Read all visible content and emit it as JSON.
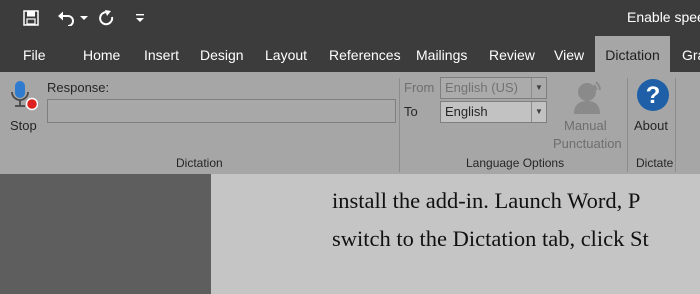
{
  "colors": {
    "title_bar": "#3c3c3c",
    "ribbon": "#a6a6a6",
    "document_page": "#c5c5c5",
    "document_gutter": "#5e5e5e",
    "mic_accent": "#2e7bcf",
    "stop_dot": "#e02020",
    "help_circle": "#1e5fa8"
  },
  "qat": {
    "save_icon": "save-icon",
    "undo_icon": "undo-icon",
    "undo_dropdown_icon": "chevron-down-icon",
    "redo_icon": "redo-icon",
    "customize_icon": "customize-qat-icon"
  },
  "title": {
    "text": "Enable spee"
  },
  "tabs": [
    {
      "label": "File"
    },
    {
      "label": "Home"
    },
    {
      "label": "Insert"
    },
    {
      "label": "Design"
    },
    {
      "label": "Layout"
    },
    {
      "label": "References"
    },
    {
      "label": "Mailings"
    },
    {
      "label": "Review"
    },
    {
      "label": "View"
    },
    {
      "label": "Dictation",
      "active": true
    },
    {
      "label": "Gra"
    }
  ],
  "ribbon": {
    "dictation_group": {
      "stop_label": "Stop",
      "response_label": "Response:",
      "response_value": "",
      "group_label": "Dictation"
    },
    "language_group": {
      "from_label": "From",
      "from_value": "English (US)",
      "to_label": "To",
      "to_value": "English",
      "manual_punctuation_line1": "Manual",
      "manual_punctuation_line2": "Punctuation",
      "group_label": "Language Options"
    },
    "dictate_group": {
      "about_label": "About",
      "group_label": "Dictate"
    }
  },
  "document": {
    "lines": [
      "install the add-in. Launch Word, P",
      "switch to the Dictation tab, click St"
    ]
  }
}
